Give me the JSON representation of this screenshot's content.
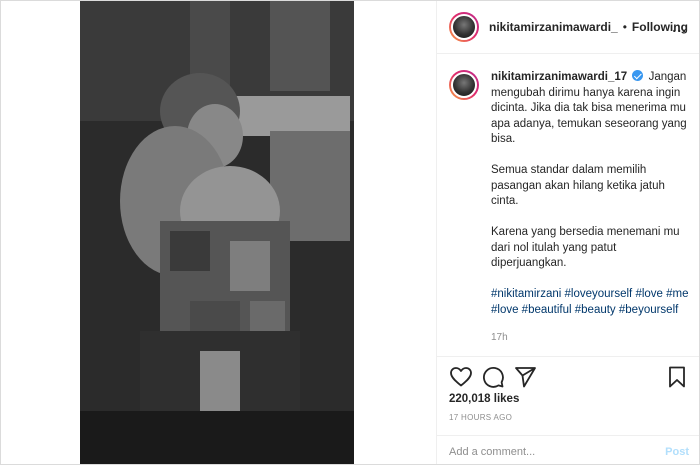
{
  "header": {
    "username": "nikitamirzanimawardi_",
    "separator": "•",
    "follow_status": "Following",
    "more_label": "..."
  },
  "caption": {
    "username": "nikitamirzanimawardi_17",
    "verified": true,
    "paragraphs": [
      "Jangan mengubah dirimu hanya karena ingin dicinta. Jika dia tak bisa menerima mu apa adanya, temukan seseorang yang bisa.",
      "Semua standar dalam memilih pasangan akan hilang ketika jatuh cinta.",
      "Karena yang bersedia menemani mu dari nol itulah yang patut diperjuangkan."
    ],
    "hashtags": "#nikitamirzani #loveyourself #love #me #love #beautiful #beauty #beyourself",
    "time_ago": "17h"
  },
  "actions": {
    "icons": [
      "heart-icon",
      "comment-icon",
      "share-icon",
      "bookmark-icon"
    ],
    "likes": "220,018 likes",
    "posted": "17 HOURS AGO"
  },
  "comment_input": {
    "placeholder": "Add a comment...",
    "post_label": "Post"
  },
  "colors": {
    "link": "#00376b",
    "verified": "#3897f0",
    "muted": "#8e8e8e",
    "post_button": "#b2dffc"
  }
}
